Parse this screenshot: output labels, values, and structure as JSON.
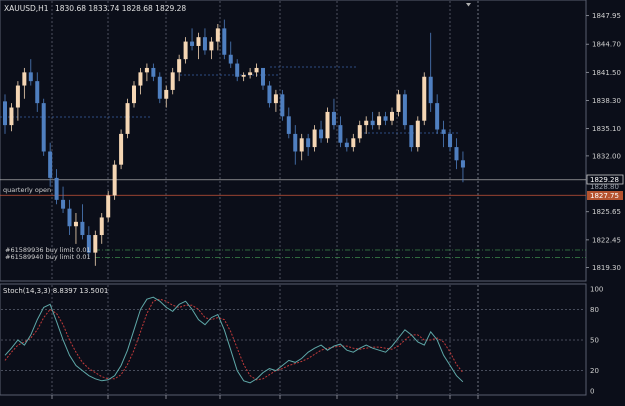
{
  "main_chart": {
    "header": "XAUUSD,H1",
    "ohlc": "1830.68 1833.74 1828.68 1829.28",
    "price_axis": [
      {
        "v": 1847.95,
        "t": "1847.95"
      },
      {
        "v": 1844.7,
        "t": "1844.70"
      },
      {
        "v": 1841.5,
        "t": "1841.50"
      },
      {
        "v": 1838.3,
        "t": "1838.30"
      },
      {
        "v": 1835.1,
        "t": "1835.10"
      },
      {
        "v": 1832.0,
        "t": "1832.00"
      },
      {
        "v": 1825.65,
        "t": "1825.65"
      },
      {
        "v": 1822.45,
        "t": "1822.45"
      },
      {
        "v": 1819.3,
        "t": "1819.30"
      }
    ],
    "bid_tag": "1829.28",
    "bid_tag_sub": "1828.80",
    "ask_tag": "1827.75",
    "quarterly_label": "quarterly open",
    "order_labels": [
      "#61589936 buy limit 0.01",
      "#61589940 buy limit 0.01"
    ],
    "date_labels": [
      "",
      "",
      "",
      "",
      "",
      "",
      "",
      "",
      ""
    ]
  },
  "stoch_panel": {
    "label": "Stoch(14,3,3) 8.8397 13.5001",
    "levels": [
      {
        "v": 100,
        "t": "100"
      },
      {
        "v": 80,
        "t": "80"
      },
      {
        "v": 50,
        "t": "50"
      },
      {
        "v": 20,
        "t": "20"
      },
      {
        "v": 0,
        "t": "0"
      }
    ]
  },
  "chart_data": {
    "type": "candlestick",
    "symbol": "XAUUSD",
    "timeframe": "H1",
    "price_range": [
      1818.0,
      1849.5
    ],
    "bid_price": 1829.28,
    "ask_line_price": 1827.75,
    "quarterly_open_price": 1828.0,
    "order_prices": [
      1821.3,
      1820.8
    ],
    "colors": {
      "up": "#f5d6b4",
      "down": "#4f7fc0",
      "main_line": "#5fa8a8",
      "signal_line": "#c23a3a",
      "ask_line": "#c8563a"
    },
    "ohlc": [
      [
        1838.2,
        1839.0,
        1834.5,
        1835.5
      ],
      [
        1835.5,
        1838.0,
        1834.8,
        1837.5
      ],
      [
        1837.5,
        1840.5,
        1836.0,
        1840.0
      ],
      [
        1840.0,
        1842.0,
        1838.5,
        1841.5
      ],
      [
        1841.5,
        1843.0,
        1840.0,
        1840.5
      ],
      [
        1840.5,
        1841.5,
        1837.0,
        1838.0
      ],
      [
        1838.0,
        1838.5,
        1832.0,
        1832.5
      ],
      [
        1832.5,
        1833.5,
        1828.5,
        1829.5
      ],
      [
        1829.5,
        1830.5,
        1826.5,
        1827.0
      ],
      [
        1827.0,
        1828.5,
        1825.5,
        1826.0
      ],
      [
        1826.0,
        1827.0,
        1823.0,
        1824.0
      ],
      [
        1824.0,
        1825.5,
        1822.0,
        1824.5
      ],
      [
        1824.5,
        1826.5,
        1822.5,
        1823.0
      ],
      [
        1823.0,
        1824.0,
        1820.5,
        1821.0
      ],
      [
        1821.0,
        1823.5,
        1819.5,
        1823.0
      ],
      [
        1823.0,
        1825.5,
        1822.0,
        1825.0
      ],
      [
        1825.0,
        1828.0,
        1824.5,
        1827.5
      ],
      [
        1827.5,
        1831.5,
        1827.0,
        1831.0
      ],
      [
        1831.0,
        1835.0,
        1830.5,
        1834.5
      ],
      [
        1834.5,
        1838.5,
        1834.0,
        1838.0
      ],
      [
        1838.0,
        1840.5,
        1837.5,
        1840.0
      ],
      [
        1840.0,
        1842.0,
        1839.0,
        1841.5
      ],
      [
        1841.5,
        1842.5,
        1840.5,
        1842.0
      ],
      [
        1842.0,
        1842.5,
        1840.5,
        1841.0
      ],
      [
        1841.0,
        1841.5,
        1838.0,
        1838.5
      ],
      [
        1838.5,
        1840.0,
        1837.5,
        1839.5
      ],
      [
        1839.5,
        1842.0,
        1839.0,
        1841.5
      ],
      [
        1841.5,
        1843.5,
        1840.5,
        1843.0
      ],
      [
        1843.0,
        1845.5,
        1842.5,
        1845.0
      ],
      [
        1845.0,
        1846.5,
        1844.0,
        1844.5
      ],
      [
        1844.5,
        1846.0,
        1843.0,
        1845.5
      ],
      [
        1845.5,
        1846.5,
        1843.5,
        1844.0
      ],
      [
        1844.0,
        1845.5,
        1843.0,
        1845.0
      ],
      [
        1845.0,
        1847.0,
        1844.0,
        1846.5
      ],
      [
        1846.5,
        1847.5,
        1843.0,
        1843.5
      ],
      [
        1843.5,
        1845.0,
        1842.0,
        1842.5
      ],
      [
        1842.5,
        1843.0,
        1840.5,
        1841.0
      ],
      [
        1841.0,
        1841.5,
        1840.5,
        1841.2
      ],
      [
        1841.2,
        1842.0,
        1840.8,
        1841.5
      ],
      [
        1841.5,
        1842.5,
        1841.0,
        1842.0
      ],
      [
        1842.0,
        1842.0,
        1839.5,
        1840.0
      ],
      [
        1840.0,
        1840.5,
        1837.5,
        1838.0
      ],
      [
        1838.0,
        1839.5,
        1837.0,
        1839.0
      ],
      [
        1839.0,
        1839.5,
        1836.0,
        1836.5
      ],
      [
        1836.5,
        1837.5,
        1834.0,
        1834.5
      ],
      [
        1834.5,
        1835.5,
        1831.0,
        1832.5
      ],
      [
        1832.5,
        1834.5,
        1831.5,
        1834.0
      ],
      [
        1834.0,
        1834.5,
        1832.0,
        1833.0
      ],
      [
        1833.0,
        1835.5,
        1832.5,
        1835.0
      ],
      [
        1835.0,
        1836.0,
        1833.5,
        1834.0
      ],
      [
        1834.0,
        1837.5,
        1833.5,
        1837.0
      ],
      [
        1837.0,
        1838.5,
        1835.0,
        1835.5
      ],
      [
        1835.5,
        1836.5,
        1833.0,
        1833.5
      ],
      [
        1833.5,
        1834.0,
        1832.5,
        1833.0
      ],
      [
        1833.0,
        1834.5,
        1832.5,
        1834.0
      ],
      [
        1834.0,
        1836.0,
        1833.5,
        1835.5
      ],
      [
        1835.5,
        1836.5,
        1834.5,
        1836.0
      ],
      [
        1836.0,
        1837.0,
        1835.0,
        1835.5
      ],
      [
        1835.5,
        1837.0,
        1835.0,
        1836.5
      ],
      [
        1836.5,
        1837.0,
        1835.5,
        1836.0
      ],
      [
        1836.0,
        1837.5,
        1835.5,
        1837.0
      ],
      [
        1837.0,
        1839.5,
        1836.5,
        1839.0
      ],
      [
        1839.0,
        1839.5,
        1835.0,
        1835.5
      ],
      [
        1835.5,
        1835.5,
        1832.5,
        1833.0
      ],
      [
        1833.0,
        1836.5,
        1832.5,
        1836.0
      ],
      [
        1836.0,
        1841.5,
        1835.5,
        1841.0
      ],
      [
        1841.0,
        1846.0,
        1837.0,
        1838.0
      ],
      [
        1838.0,
        1839.0,
        1834.5,
        1835.0
      ],
      [
        1835.0,
        1836.0,
        1833.0,
        1834.5
      ],
      [
        1834.5,
        1835.0,
        1832.5,
        1833.0
      ],
      [
        1833.0,
        1834.0,
        1830.5,
        1831.5
      ],
      [
        1831.5,
        1832.5,
        1829.0,
        1830.68
      ]
    ],
    "stoch_main": [
      35,
      42,
      50,
      45,
      55,
      70,
      82,
      85,
      68,
      50,
      35,
      25,
      20,
      15,
      12,
      10,
      11,
      15,
      25,
      40,
      60,
      80,
      90,
      92,
      88,
      82,
      78,
      85,
      88,
      80,
      70,
      65,
      72,
      75,
      60,
      40,
      20,
      10,
      8,
      12,
      18,
      22,
      20,
      25,
      30,
      28,
      32,
      38,
      42,
      45,
      40,
      44,
      46,
      40,
      38,
      42,
      45,
      42,
      40,
      38,
      44,
      52,
      60,
      55,
      48,
      45,
      58,
      50,
      35,
      25,
      15,
      9
    ],
    "stoch_signal": [
      30,
      38,
      45,
      48,
      52,
      60,
      72,
      80,
      76,
      65,
      50,
      38,
      28,
      22,
      18,
      14,
      12,
      12,
      16,
      26,
      40,
      58,
      76,
      88,
      90,
      88,
      84,
      82,
      84,
      84,
      80,
      72,
      70,
      72,
      70,
      58,
      42,
      26,
      15,
      11,
      12,
      16,
      20,
      22,
      25,
      27,
      29,
      32,
      36,
      40,
      42,
      43,
      44,
      44,
      42,
      41,
      42,
      43,
      43,
      42,
      41,
      44,
      50,
      55,
      55,
      50,
      50,
      52,
      48,
      38,
      26,
      18
    ]
  }
}
